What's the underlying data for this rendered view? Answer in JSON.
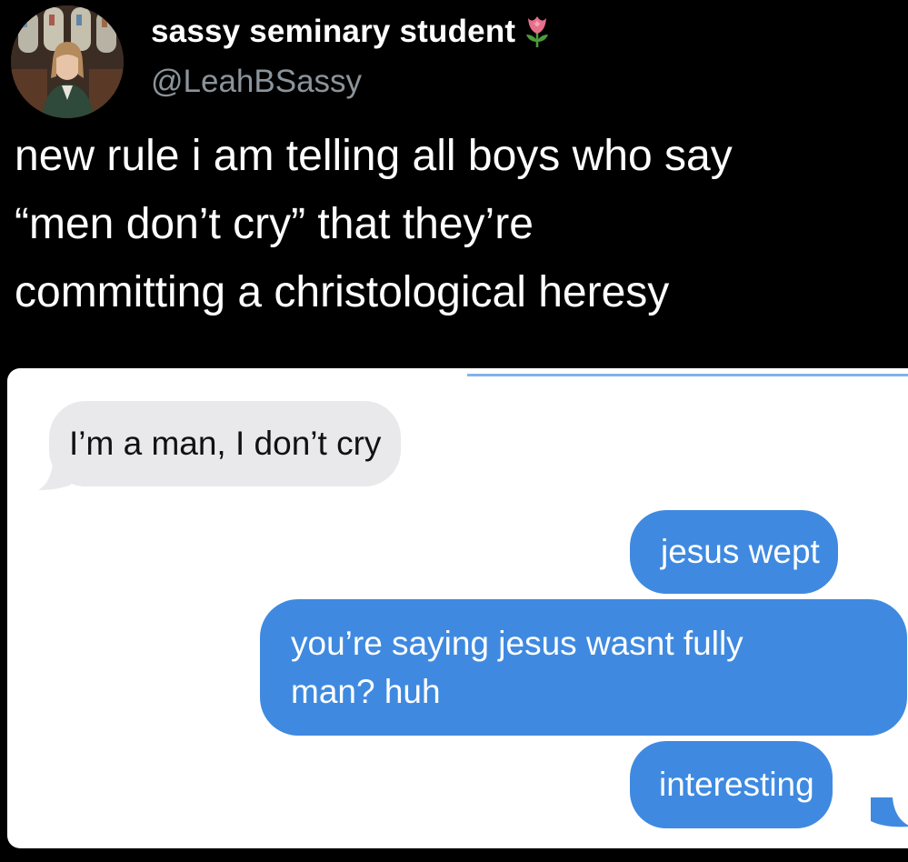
{
  "tweet": {
    "display_name": "sassy seminary student",
    "badge_icon": "tulip-icon",
    "handle": "@LeahBSassy",
    "lines": [
      "new rule i am telling all boys who say",
      "“men don’t cry” that they’re",
      "committing a christological heresy"
    ]
  },
  "conversation": {
    "messages": [
      {
        "from": "them",
        "lines": [
          "I’m a man, I don’t cry"
        ]
      },
      {
        "from": "me",
        "lines": [
          "jesus wept"
        ]
      },
      {
        "from": "me",
        "lines": [
          "you’re saying jesus wasnt fully",
          "man? huh"
        ]
      },
      {
        "from": "me",
        "lines": [
          "interesting"
        ]
      }
    ]
  },
  "colors": {
    "background": "#000000",
    "handle": "#8b949b",
    "sent_bubble": "#3f8ae0",
    "received_bubble": "#e9e9eb",
    "tulip_pink": "#e6708a",
    "tulip_green": "#4e9a3c"
  }
}
